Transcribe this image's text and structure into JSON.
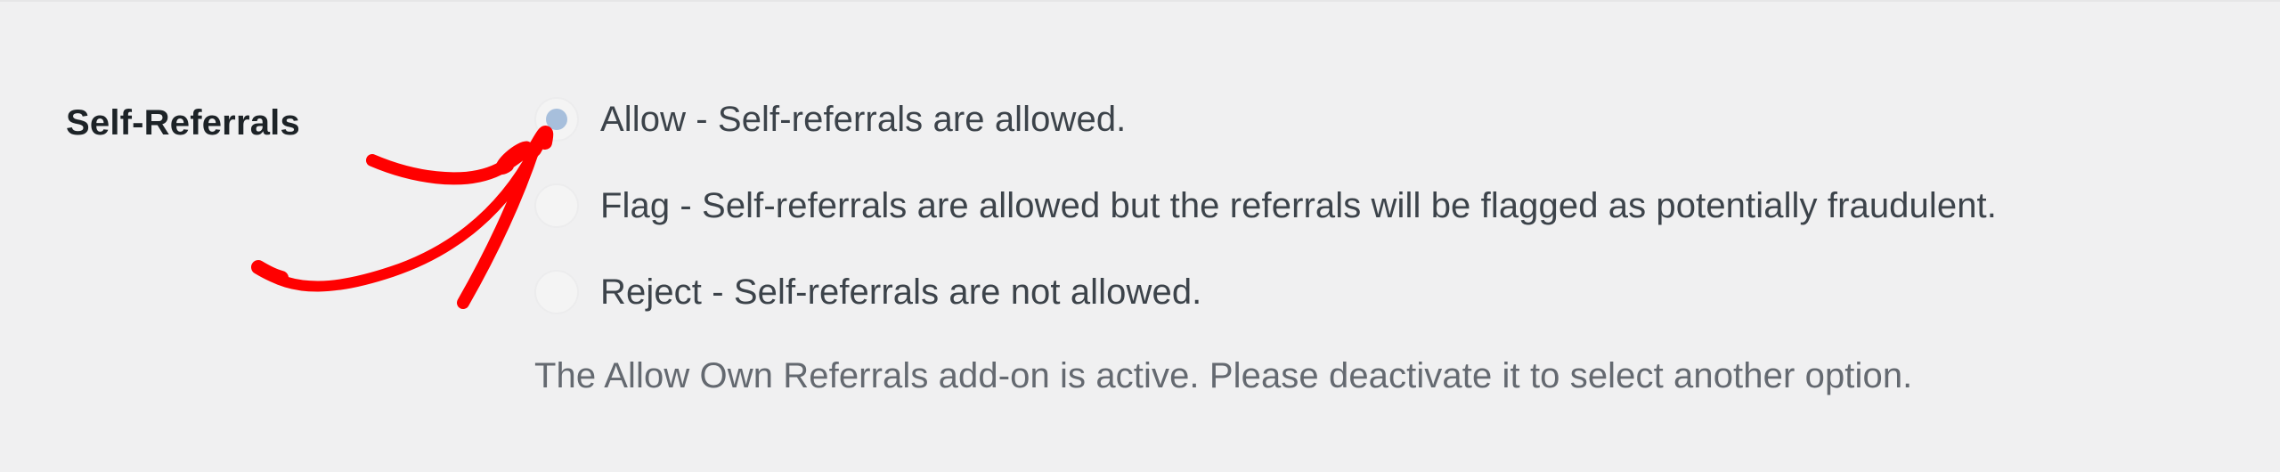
{
  "setting": {
    "label": "Self-Referrals",
    "options": [
      {
        "label": "Allow - Self-referrals are allowed.",
        "selected": true
      },
      {
        "label": "Flag - Self-referrals are allowed but the referrals will be flagged as potentially fraudulent.",
        "selected": false
      },
      {
        "label": "Reject - Self-referrals are not allowed.",
        "selected": false
      }
    ],
    "description": "The Allow Own Referrals add-on is active. Please deactivate it to select another option."
  },
  "annotation": {
    "icon": "hand-drawn-arrow-icon",
    "color": "#ff0000"
  },
  "colors": {
    "background": "#f0f0f1",
    "radio_selected_dot": "#a7bfdc"
  }
}
